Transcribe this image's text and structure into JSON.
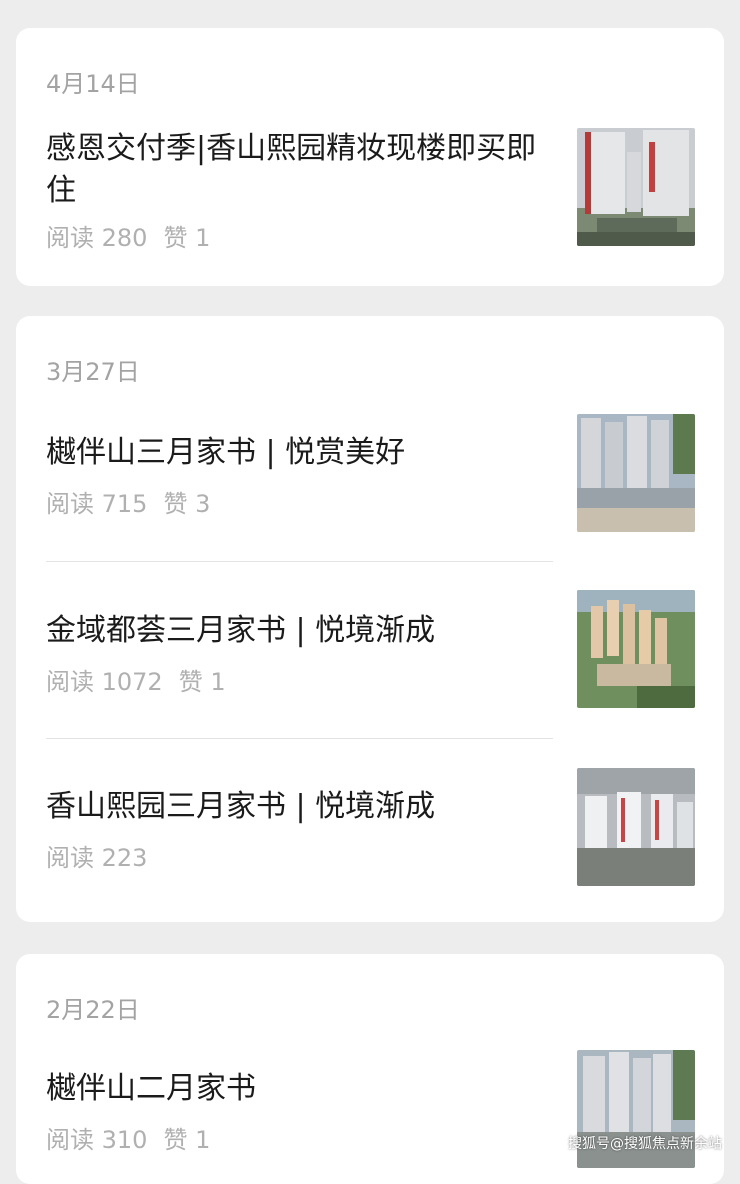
{
  "groups": [
    {
      "date": "4月14日",
      "articles": [
        {
          "title": "感恩交付季|香山熙园精妆现楼即买即住",
          "reads": "阅读 280",
          "likes": "赞 1",
          "thumb": "tower-render-icon"
        }
      ]
    },
    {
      "date": "3月27日",
      "articles": [
        {
          "title": "樾伴山三月家书 | 悦赏美好",
          "reads": "阅读 715",
          "likes": "赞 3",
          "thumb": "construction-site-icon"
        },
        {
          "title": "金域都荟三月家书 | 悦境渐成",
          "reads": "阅读 1072",
          "likes": "赞 1",
          "thumb": "aerial-complex-icon"
        },
        {
          "title": "香山熙园三月家书 |  悦境渐成",
          "reads": "阅读 223",
          "likes": "",
          "thumb": "city-buildings-icon"
        }
      ]
    },
    {
      "date": "2月22日",
      "articles": [
        {
          "title": "樾伴山二月家书",
          "reads": "阅读 310",
          "likes": "赞 1",
          "thumb": "tower-photo-icon"
        }
      ]
    }
  ],
  "watermark": "搜狐号@搜狐焦点新余站"
}
